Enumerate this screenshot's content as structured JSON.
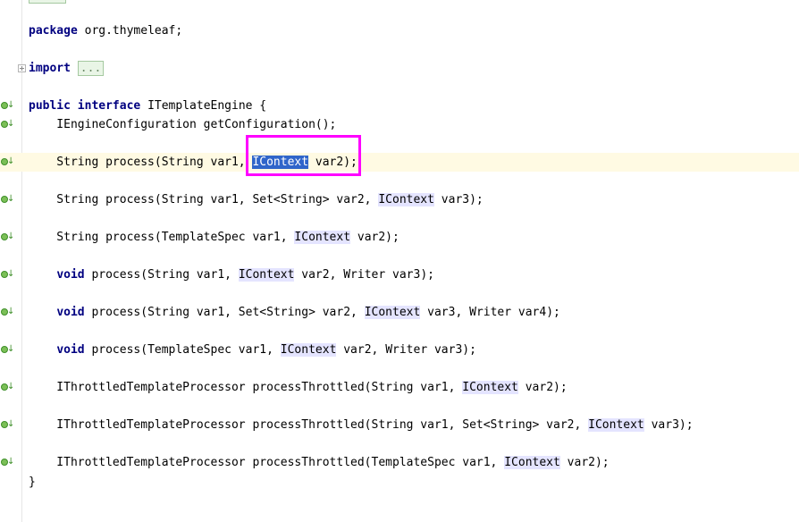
{
  "editor": {
    "lines": {
      "package_kw": "package",
      "package_name": " org.thymeleaf;",
      "import_kw": "import",
      "import_fold": "...",
      "iface_public": "public",
      "iface_interface": "interface",
      "iface_name": " ITemplateEngine {",
      "l1": "    IEngineConfiguration getConfiguration();",
      "l2_pre": "    String process(String var1, ",
      "l2_ctx": "IContext",
      "l2_post": " var2);",
      "l3_pre": "    String process(String var1, Set<String> var2, ",
      "l3_ctx": "IContext",
      "l3_post": " var3);",
      "l4_pre": "    String process(TemplateSpec var1, ",
      "l4_ctx": "IContext",
      "l4_post": " var2);",
      "l5_kw": "void",
      "l5_pre": " process(String var1, ",
      "l5_ctx": "IContext",
      "l5_post": " var2, Writer var3);",
      "l6_kw": "void",
      "l6_pre": " process(String var1, Set<String> var2, ",
      "l6_ctx": "IContext",
      "l6_post": " var3, Writer var4);",
      "l7_kw": "void",
      "l7_pre": " process(TemplateSpec var1, ",
      "l7_ctx": "IContext",
      "l7_post": " var2, Writer var3);",
      "l8_pre": "    IThrottledTemplateProcessor processThrottled(String var1, ",
      "l8_ctx": "IContext",
      "l8_post": " var2);",
      "l9_pre": "    IThrottledTemplateProcessor processThrottled(String var1, Set<String> var2, ",
      "l9_ctx": "IContext",
      "l9_post": " var3);",
      "l10_pre": "    IThrottledTemplateProcessor processThrottled(TemplateSpec var1, ",
      "l10_ctx": "IContext",
      "l10_post": " var2);",
      "close": "}"
    }
  },
  "colors": {
    "keyword": "#000080",
    "usage_highlight": "#e4e4ff",
    "selection": "#2f65ca",
    "annotation": "#ff00ff",
    "current_line": "#fffae3"
  },
  "icons": {
    "gutter_marker": "implementing-method-icon",
    "fold": "expand-fold-icon"
  }
}
